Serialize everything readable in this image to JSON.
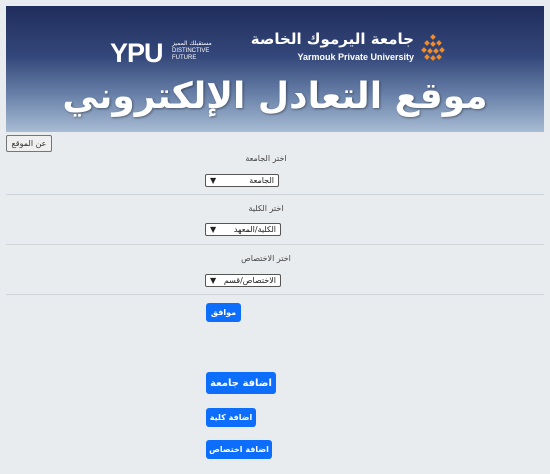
{
  "banner": {
    "ypu_logo": {
      "mark": "YPU",
      "tagline_ar": "مستقبلك المميز",
      "tagline_en": "DISTINCTIVE\nFUTURE"
    },
    "university": {
      "name_ar": "جامعة اليرموك الخاصة",
      "name_en": "Yarmouk Private University",
      "emblem": "yarmouk-emblem-icon"
    },
    "title": "موقع التعادل الإلكتروني"
  },
  "about_button": "عن الموقع",
  "fields": {
    "university": {
      "label": "اختر الجامعة",
      "value": "الجامعة"
    },
    "college": {
      "label": "اختر الكلية",
      "value": "الكلية/المعهد"
    },
    "major": {
      "label": "اختر الاختصاص",
      "value": "الاختصاص/قسم"
    }
  },
  "buttons": {
    "confirm": "موافق",
    "add_university": "اضافة جامعة",
    "add_college": "اضافة كلية",
    "add_major": "اضافة اختصاص"
  },
  "colors": {
    "primary": "#0d6efd",
    "banner_dark": "#1f2d5c",
    "background": "#e9ecef",
    "emblem": "#f28c28"
  }
}
